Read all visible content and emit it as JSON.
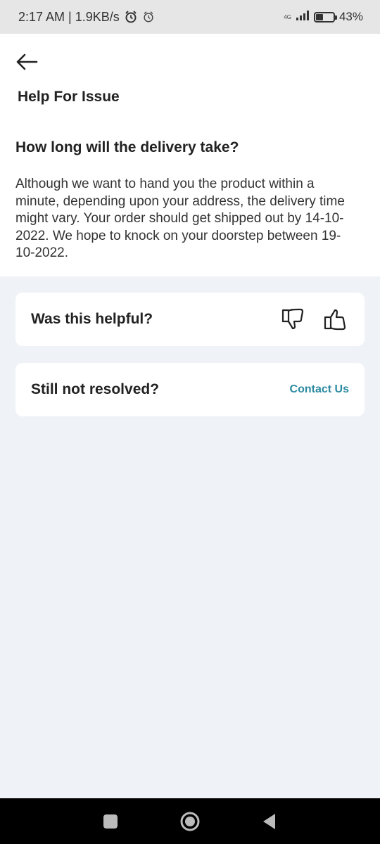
{
  "status_bar": {
    "time": "2:17 AM | 1.9KB/s",
    "network": "4G",
    "battery": "43%",
    "battery_level": 0.43
  },
  "header": {
    "back_icon": "arrow-left-icon",
    "title": "Help For Issue"
  },
  "article": {
    "question": "How long will the delivery take?",
    "answer": "Although we want to hand you the product within a minute, depending upon your address, the delivery time might vary. Your order should get shipped out by 14-10-2022. We hope to knock on your doorstep between 19-10-2022."
  },
  "feedback": {
    "label": "Was this helpful?",
    "icons": [
      "thumbs-down-icon",
      "thumbs-up-icon"
    ]
  },
  "support": {
    "label": "Still not resolved?",
    "link": "Contact Us",
    "link_color": "#2b8aa1"
  },
  "nav": {
    "icons": [
      "recents-square-icon",
      "home-circle-icon",
      "back-triangle-icon"
    ]
  }
}
